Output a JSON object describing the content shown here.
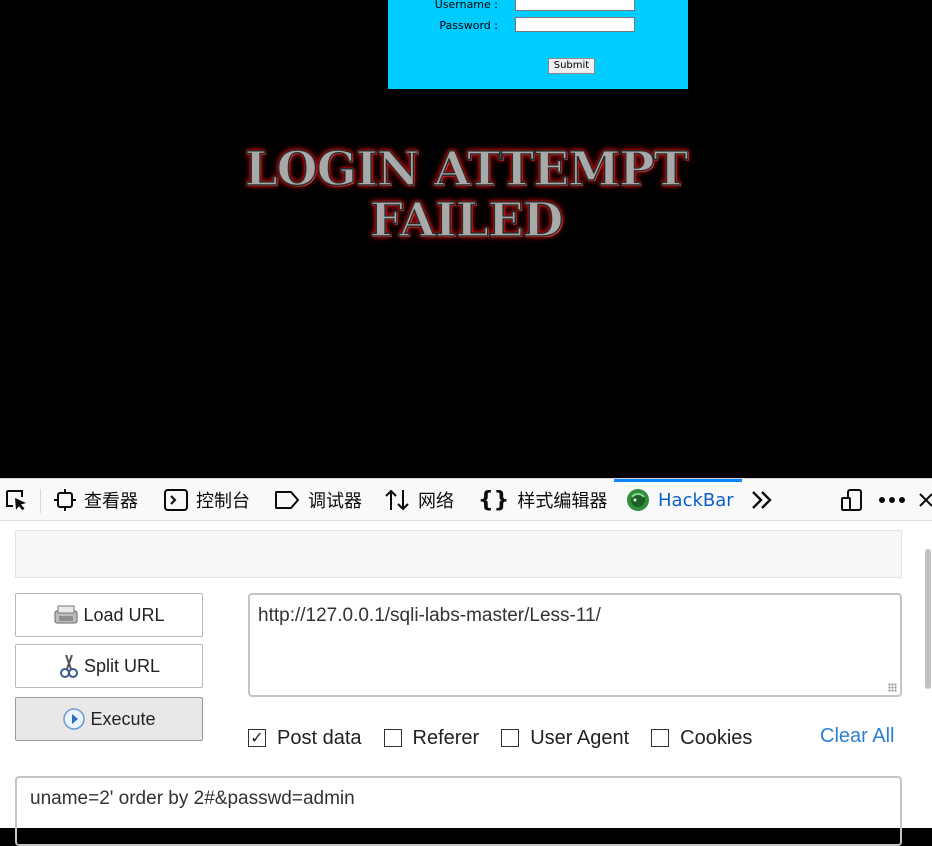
{
  "login_form": {
    "username_label": "Username :",
    "password_label": "Password :",
    "submit_label": "Submit",
    "bg_color": "#00ccff"
  },
  "banner": {
    "line1": "LOGIN ATTEMPT",
    "line2": "FAILED"
  },
  "devtools": {
    "tabs": [
      {
        "label": "查看器",
        "icon": "inspector-icon"
      },
      {
        "label": "控制台",
        "icon": "console-icon"
      },
      {
        "label": "调试器",
        "icon": "debugger-icon"
      },
      {
        "label": "网络",
        "icon": "network-icon"
      },
      {
        "label": "样式编辑器",
        "icon": "style-editor-icon"
      },
      {
        "label": "HackBar",
        "icon": "hackbar-icon",
        "active": true
      }
    ],
    "accent": "#0a84ff"
  },
  "hackbar": {
    "load_url_label": "Load URL",
    "split_url_label": "Split URL",
    "execute_label": "Execute",
    "url_value": "http://127.0.0.1/sqli-labs-master/Less-11/",
    "options": [
      {
        "label": "Post data",
        "checked": true
      },
      {
        "label": "Referer",
        "checked": false
      },
      {
        "label": "User Agent",
        "checked": false
      },
      {
        "label": "Cookies",
        "checked": false
      }
    ],
    "clear_all_label": "Clear All",
    "post_data_value": "uname=2' order by 2#&passwd=admin"
  }
}
